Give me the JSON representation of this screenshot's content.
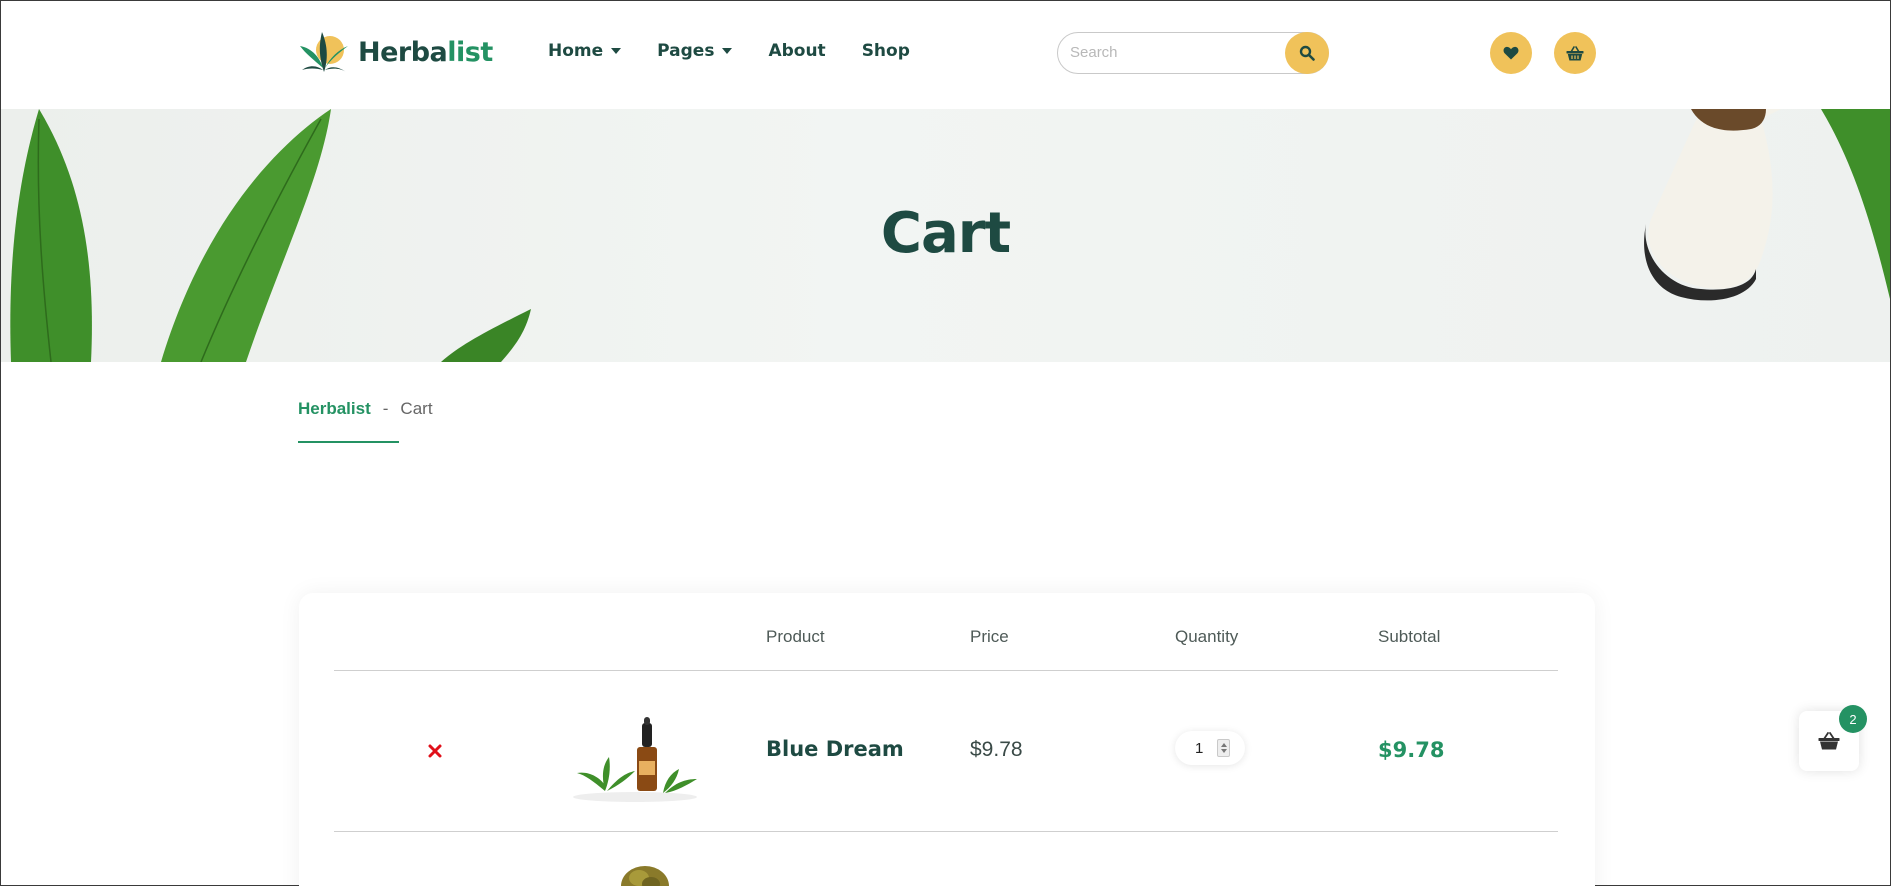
{
  "header": {
    "logo_part1": "Herba",
    "logo_part2": "list",
    "nav": [
      {
        "label": "Home",
        "has_dropdown": true
      },
      {
        "label": "Pages",
        "has_dropdown": true
      },
      {
        "label": "About",
        "has_dropdown": false
      },
      {
        "label": "Shop",
        "has_dropdown": false
      }
    ],
    "search_placeholder": "Search",
    "icons": [
      "search-icon",
      "heart-icon",
      "basket-icon"
    ]
  },
  "hero": {
    "title": "Cart"
  },
  "breadcrumb": {
    "home": "Herbalist",
    "separator": "-",
    "current": "Cart"
  },
  "cart": {
    "headers": {
      "product": "Product",
      "price": "Price",
      "quantity": "Quantity",
      "subtotal": "Subtotal"
    },
    "items": [
      {
        "name": "Blue Dream",
        "price": "$9.78",
        "quantity": "1",
        "subtotal": "$9.78"
      }
    ]
  },
  "floating_cart": {
    "count": "2"
  },
  "colors": {
    "primary": "#1e4a42",
    "accent": "#249263",
    "yellow": "#f0c25a",
    "remove": "#e0101a"
  }
}
